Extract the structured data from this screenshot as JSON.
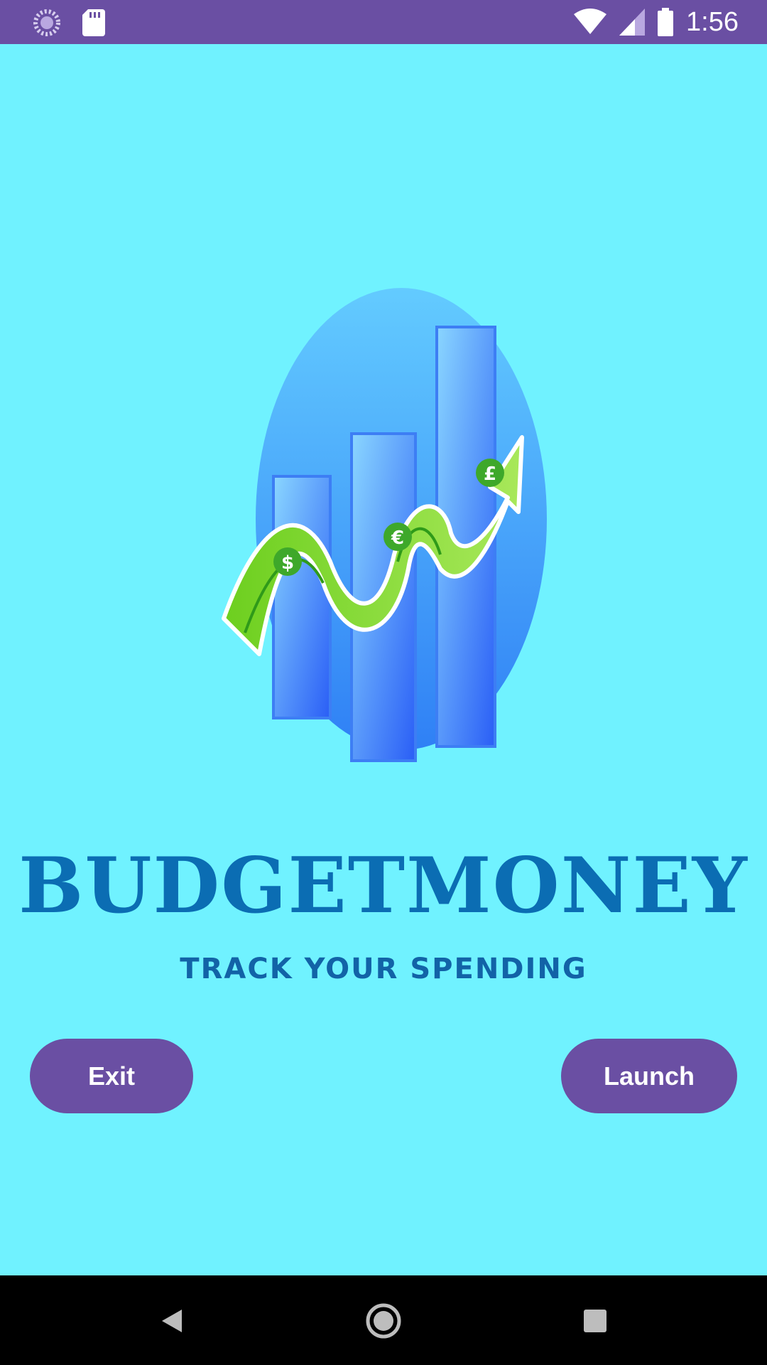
{
  "status_bar": {
    "time": "1:56",
    "icons": [
      "loading-icon",
      "sd-card-icon",
      "wifi-icon",
      "signal-icon",
      "battery-icon"
    ]
  },
  "splash": {
    "brand_name": "BUDGETMONEY",
    "tagline": "TRACK YOUR SPENDING",
    "logo_currency_symbols": [
      "$",
      "€",
      "£"
    ]
  },
  "buttons": {
    "exit_label": "Exit",
    "launch_label": "Launch"
  },
  "nav_bar": {
    "icons": [
      "back-icon",
      "home-icon",
      "recents-icon"
    ]
  },
  "colors": {
    "background": "#70f2ff",
    "accent": "#6a4fa3",
    "brand_text": "#0b6db3",
    "money_green": "#7dd321"
  }
}
